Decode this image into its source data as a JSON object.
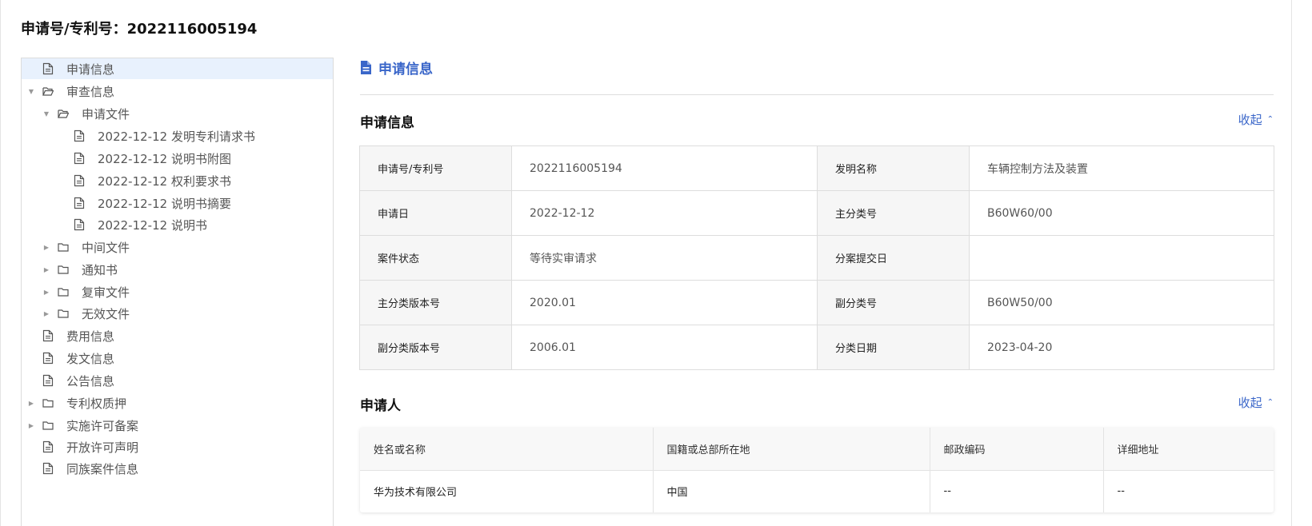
{
  "page_title": "申请号/专利号：2022116005194",
  "tree": [
    {
      "label": "申请信息",
      "icon": "file-icon",
      "level": 0,
      "caret": "none",
      "selected": true
    },
    {
      "label": "审查信息",
      "icon": "folder-open-icon",
      "level": 0,
      "caret": "down",
      "selected": false
    },
    {
      "label": "申请文件",
      "icon": "folder-open-icon",
      "level": 1,
      "caret": "down",
      "selected": false
    },
    {
      "label": "2022-12-12 发明专利请求书",
      "icon": "file-icon",
      "level": 2,
      "caret": "none",
      "selected": false
    },
    {
      "label": "2022-12-12 说明书附图",
      "icon": "file-icon",
      "level": 2,
      "caret": "none",
      "selected": false
    },
    {
      "label": "2022-12-12 权利要求书",
      "icon": "file-icon",
      "level": 2,
      "caret": "none",
      "selected": false
    },
    {
      "label": "2022-12-12 说明书摘要",
      "icon": "file-icon",
      "level": 2,
      "caret": "none",
      "selected": false
    },
    {
      "label": "2022-12-12 说明书",
      "icon": "file-icon",
      "level": 2,
      "caret": "none",
      "selected": false
    },
    {
      "label": "中间文件",
      "icon": "folder-icon",
      "level": 1,
      "caret": "right",
      "selected": false
    },
    {
      "label": "通知书",
      "icon": "folder-icon",
      "level": 1,
      "caret": "right",
      "selected": false
    },
    {
      "label": "复审文件",
      "icon": "folder-icon",
      "level": 1,
      "caret": "right",
      "selected": false
    },
    {
      "label": "无效文件",
      "icon": "folder-icon",
      "level": 1,
      "caret": "right",
      "selected": false
    },
    {
      "label": "费用信息",
      "icon": "file-icon",
      "level": 0,
      "caret": "none",
      "selected": false
    },
    {
      "label": "发文信息",
      "icon": "file-icon",
      "level": 0,
      "caret": "none",
      "selected": false
    },
    {
      "label": "公告信息",
      "icon": "file-icon",
      "level": 0,
      "caret": "none",
      "selected": false
    },
    {
      "label": "专利权质押",
      "icon": "folder-icon",
      "level": 0,
      "caret": "right",
      "selected": false
    },
    {
      "label": "实施许可备案",
      "icon": "folder-icon",
      "level": 0,
      "caret": "right",
      "selected": false
    },
    {
      "label": "开放许可声明",
      "icon": "file-icon",
      "level": 0,
      "caret": "none",
      "selected": false
    },
    {
      "label": "同族案件信息",
      "icon": "file-icon",
      "level": 0,
      "caret": "none",
      "selected": false
    }
  ],
  "section_header": "申请信息",
  "application_info": {
    "title": "申请信息",
    "collapse_label": "收起",
    "rows": [
      [
        {
          "k": "申请号/专利号",
          "v": "2022116005194"
        },
        {
          "k": "发明名称",
          "v": "车辆控制方法及装置"
        }
      ],
      [
        {
          "k": "申请日",
          "v": "2022-12-12"
        },
        {
          "k": "主分类号",
          "v": "B60W60/00"
        }
      ],
      [
        {
          "k": "案件状态",
          "v": "等待实审请求"
        },
        {
          "k": "分案提交日",
          "v": ""
        }
      ],
      [
        {
          "k": "主分类版本号",
          "v": "2020.01"
        },
        {
          "k": "副分类号",
          "v": "B60W50/00"
        }
      ],
      [
        {
          "k": "副分类版本号",
          "v": "2006.01"
        },
        {
          "k": "分类日期",
          "v": "2023-04-20"
        }
      ]
    ]
  },
  "applicant": {
    "title": "申请人",
    "collapse_label": "收起",
    "columns": [
      "姓名或名称",
      "国籍或总部所在地",
      "邮政编码",
      "详细地址"
    ],
    "rows": [
      [
        "华为技术有限公司",
        "中国",
        "--",
        "--"
      ]
    ]
  },
  "colors": {
    "accent": "#3a66c9",
    "selected_bg": "#e8f1fd"
  }
}
